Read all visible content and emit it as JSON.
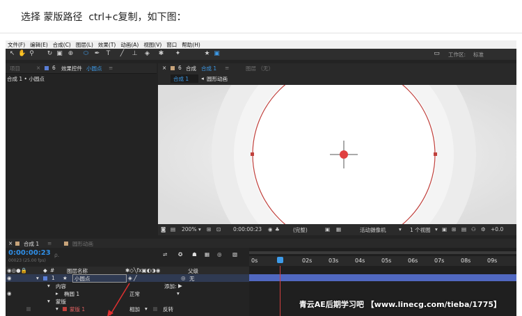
{
  "caption": "选择 蒙版路径  ctrl+c复制，如下图：",
  "menu": [
    "文件(F)",
    "编辑(E)",
    "合成(C)",
    "图层(L)",
    "效果(T)",
    "动画(A)",
    "视图(V)",
    "窗口",
    "帮助(H)"
  ],
  "toolbar": {
    "workspace_label": "工作区:",
    "workspace_value": "标准"
  },
  "project_panel": {
    "tab_project": "项目",
    "tab_effects": "效果控件",
    "effects_layer": "小圆点",
    "breadcrumb": "合成 1 • 小圆点"
  },
  "comp_panel": {
    "tab_prefix": "合成",
    "tab_name": "合成 1",
    "layer_tab": "图层 （无）",
    "flow_current": "合成 1",
    "flow_next": "圆形动画"
  },
  "viewer_bar": {
    "zoom": "200%",
    "timecode": "0:00:00:23",
    "quality": "(完整)",
    "camera": "活动摄像机",
    "views": "1 个视图",
    "exposure": "+0.0"
  },
  "timeline": {
    "tab_comp": "合成 1",
    "tab_other": "圆形动画",
    "timecode": "0:00:00:23",
    "fps": "00023 (25.00 fps)",
    "search_placeholder": "ρ.",
    "col_layer_name": "图层名称",
    "col_parent": "父级",
    "ruler_ticks": [
      "0s",
      "01s",
      "02s",
      "03s",
      "04s",
      "05s",
      "06s",
      "07s",
      "08s",
      "09s"
    ],
    "layer": {
      "index": "1",
      "name": "小圆点",
      "parent": "无"
    },
    "contents_label": "内容",
    "add_label": "添加:",
    "ellipse_label": "椭圆 1",
    "blend_mode": "正常",
    "masks_label": "蒙版",
    "mask_name": "蒙版 1",
    "mask_mode": "相加",
    "invert_label": "反转"
  },
  "watermark": "青云AE后期学习吧 【www.linecg.com/tieba/1775】",
  "colors": {
    "accent": "#3d9be9",
    "timecode": "#2f8fe8",
    "mask_path": "#c0403c",
    "layer_bar": "#5068c0"
  }
}
